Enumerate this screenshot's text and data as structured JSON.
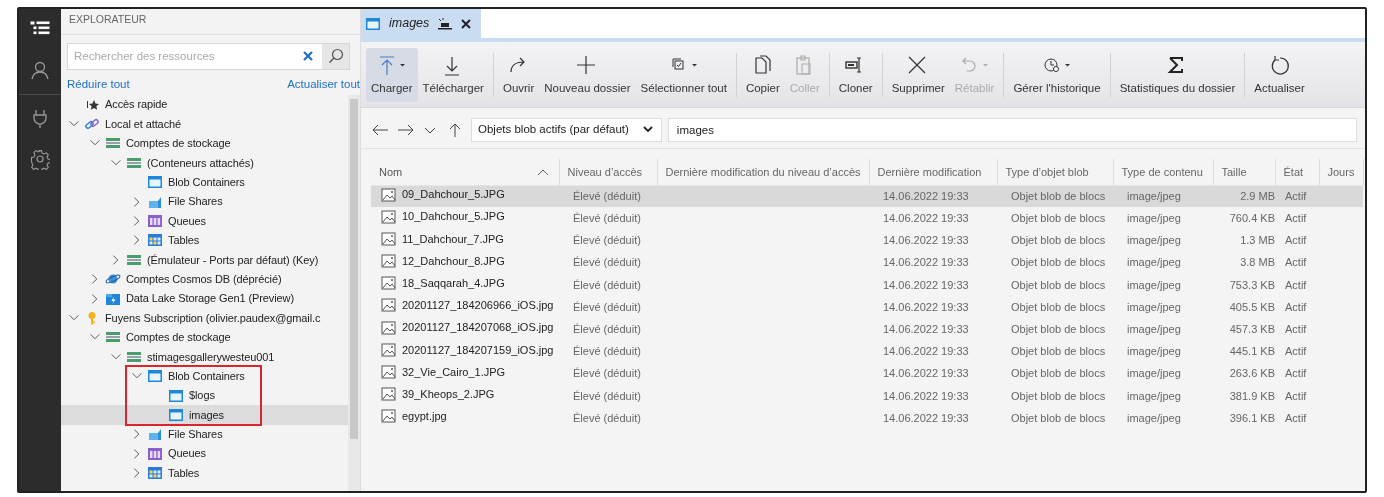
{
  "activity_bar": [
    {
      "kind": "explorer",
      "selected": true
    },
    {
      "kind": "account",
      "selected": false
    },
    {
      "kind": "connect",
      "selected": false
    },
    {
      "kind": "settings",
      "selected": false
    }
  ],
  "explorer": {
    "title": "EXPLORATEUR",
    "search": {
      "placeholder": "Rechercher des ressources"
    },
    "collapse_all": "Réduire tout",
    "refresh_all": "Actualiser tout",
    "tree": [
      {
        "label": "Accès rapide",
        "kind": "quick",
        "selected": false
      },
      {
        "label": "Local et attaché",
        "kind": "link",
        "selected": false,
        "expanded": true,
        "children": [
          {
            "label": "Comptes de stockage",
            "kind": "storage",
            "selected": false,
            "expanded": true,
            "children": [
              {
                "label": "(Conteneurs attachés)",
                "kind": "storage",
                "selected": false,
                "expanded": true,
                "children": [
                  {
                    "label": "Blob Containers",
                    "kind": "container",
                    "selected": false
                  },
                  {
                    "label": "File Shares",
                    "kind": "fileshare",
                    "selected": false,
                    "expanded": false
                  },
                  {
                    "label": "Queues",
                    "kind": "queue",
                    "selected": false,
                    "expanded": false
                  },
                  {
                    "label": "Tables",
                    "kind": "table",
                    "selected": false,
                    "expanded": false
                  }
                ]
              },
              {
                "label": "(Émulateur - Ports par défaut) (Key)",
                "kind": "storage",
                "selected": false,
                "expanded": false
              }
            ]
          },
          {
            "label": "Comptes Cosmos DB (déprécié)",
            "kind": "cosmos",
            "selected": false,
            "expanded": false
          },
          {
            "label": "Data Lake Storage Gen1 (Preview)",
            "kind": "datalake",
            "selected": false,
            "expanded": false
          }
        ]
      },
      {
        "label": "Fuyens Subscription (olivier.paudex@gmail.c",
        "kind": "key",
        "selected": false,
        "expanded": true,
        "children": [
          {
            "label": "Comptes de stockage",
            "kind": "storage",
            "selected": false,
            "expanded": true,
            "children": [
              {
                "label": "stimagesgallerywesteu001",
                "kind": "storage",
                "selected": false,
                "expanded": true,
                "children": [
                  {
                    "label": "Blob Containers",
                    "kind": "container",
                    "selected": false,
                    "expanded": true,
                    "highlighted": true,
                    "children": [
                      {
                        "label": "$logs",
                        "kind": "container",
                        "selected": false
                      },
                      {
                        "label": "images",
                        "kind": "container",
                        "selected": true
                      }
                    ]
                  },
                  {
                    "label": "File Shares",
                    "kind": "fileshare",
                    "selected": false,
                    "expanded": false
                  },
                  {
                    "label": "Queues",
                    "kind": "queue",
                    "selected": false,
                    "expanded": false
                  },
                  {
                    "label": "Tables",
                    "kind": "table",
                    "selected": false,
                    "expanded": false
                  }
                ]
              }
            ]
          }
        ]
      }
    ]
  },
  "tabs": [
    {
      "label": "images",
      "selected": true
    }
  ],
  "toolbar": {
    "groups": [
      [
        {
          "label": "Charger",
          "kind": "upload",
          "pressed": true,
          "disabled": false,
          "dropdown": true
        },
        {
          "label": "Télécharger",
          "kind": "download",
          "pressed": false,
          "disabled": false,
          "dropdown": false
        }
      ],
      [
        {
          "label": "Ouvrir",
          "kind": "open",
          "pressed": false,
          "disabled": false,
          "dropdown": false
        },
        {
          "label": "Nouveau dossier",
          "kind": "plus",
          "pressed": false,
          "disabled": false,
          "dropdown": false
        },
        {
          "label": "Sélectionner tout",
          "kind": "selectall",
          "pressed": false,
          "disabled": false,
          "dropdown": true
        }
      ],
      [
        {
          "label": "Copier",
          "kind": "copy",
          "pressed": false,
          "disabled": false,
          "dropdown": false
        },
        {
          "label": "Coller",
          "kind": "paste",
          "pressed": false,
          "disabled": true,
          "dropdown": false
        }
      ],
      [
        {
          "label": "Cloner",
          "kind": "clone",
          "pressed": false,
          "disabled": false,
          "dropdown": false
        }
      ],
      [
        {
          "label": "Supprimer",
          "kind": "delete",
          "pressed": false,
          "disabled": false,
          "dropdown": false
        },
        {
          "label": "Rétablir",
          "kind": "undo",
          "pressed": false,
          "disabled": true,
          "dropdown": true
        }
      ],
      [
        {
          "label": "Gérer l'historique",
          "kind": "history",
          "pressed": false,
          "disabled": false,
          "dropdown": true
        }
      ],
      [
        {
          "label": "Statistiques du dossier",
          "kind": "sigma",
          "pressed": false,
          "disabled": false,
          "dropdown": false
        }
      ],
      [
        {
          "label": "Actualiser",
          "kind": "refresh",
          "pressed": false,
          "disabled": false,
          "dropdown": false
        }
      ]
    ]
  },
  "address_bar": {
    "filter": "Objets blob actifs (par défaut)",
    "path": "images"
  },
  "table": {
    "columns": [
      {
        "label": "Nom",
        "sorted": true
      },
      {
        "label": "Niveau d’accès",
        "sorted": false
      },
      {
        "label": "Dernière modification du niveau d’accès",
        "sorted": false
      },
      {
        "label": "Dernière modification",
        "sorted": false
      },
      {
        "label": "Type d’objet blob",
        "sorted": false
      },
      {
        "label": "Type de contenu",
        "sorted": false
      },
      {
        "label": "Taille",
        "sorted": false
      },
      {
        "label": "État",
        "sorted": false
      },
      {
        "label": "Jours",
        "sorted": false
      }
    ],
    "rows": [
      {
        "selected": true,
        "cells": [
          "09_Dahchour_5.JPG",
          "Élevé (déduit)",
          "",
          "14.06.2022 19:33",
          "Objet blob de blocs",
          "image/jpeg",
          "2.9 MB",
          "Actif"
        ]
      },
      {
        "selected": false,
        "cells": [
          "10_Dahchour_5.JPG",
          "Élevé (déduit)",
          "",
          "14.06.2022 19:33",
          "Objet blob de blocs",
          "image/jpeg",
          "760.4 KB",
          "Actif"
        ]
      },
      {
        "selected": false,
        "cells": [
          "11_Dahchour_7.JPG",
          "Élevé (déduit)",
          "",
          "14.06.2022 19:33",
          "Objet blob de blocs",
          "image/jpeg",
          "1.3 MB",
          "Actif"
        ]
      },
      {
        "selected": false,
        "cells": [
          "12_Dahchour_8.JPG",
          "Élevé (déduit)",
          "",
          "14.06.2022 19:33",
          "Objet blob de blocs",
          "image/jpeg",
          "3.8 MB",
          "Actif"
        ]
      },
      {
        "selected": false,
        "cells": [
          "18_Saqqarah_4.JPG",
          "Élevé (déduit)",
          "",
          "14.06.2022 19:33",
          "Objet blob de blocs",
          "image/jpeg",
          "753.3 KB",
          "Actif"
        ]
      },
      {
        "selected": false,
        "cells": [
          "20201127_184206966_iOS.jpg",
          "Élevé (déduit)",
          "",
          "14.06.2022 19:33",
          "Objet blob de blocs",
          "image/jpeg",
          "405.5 KB",
          "Actif"
        ]
      },
      {
        "selected": false,
        "cells": [
          "20201127_184207068_iOS.jpg",
          "Élevé (déduit)",
          "",
          "14.06.2022 19:33",
          "Objet blob de blocs",
          "image/jpeg",
          "457.3 KB",
          "Actif"
        ]
      },
      {
        "selected": false,
        "cells": [
          "20201127_184207159_iOS.jpg",
          "Élevé (déduit)",
          "",
          "14.06.2022 19:33",
          "Objet blob de blocs",
          "image/jpeg",
          "445.1 KB",
          "Actif"
        ]
      },
      {
        "selected": false,
        "cells": [
          "32_Vie_Cairo_1.JPG",
          "Élevé (déduit)",
          "",
          "14.06.2022 19:33",
          "Objet blob de blocs",
          "image/jpeg",
          "263.6 KB",
          "Actif"
        ]
      },
      {
        "selected": false,
        "cells": [
          "39_Kheops_2.JPG",
          "Élevé (déduit)",
          "",
          "14.06.2022 19:33",
          "Objet blob de blocs",
          "image/jpeg",
          "381.9 KB",
          "Actif"
        ]
      },
      {
        "selected": false,
        "cells": [
          "egypt.jpg",
          "Élevé (déduit)",
          "",
          "14.06.2022 19:33",
          "Objet blob de blocs",
          "image/jpeg",
          "396.1 KB",
          "Actif"
        ]
      }
    ]
  }
}
